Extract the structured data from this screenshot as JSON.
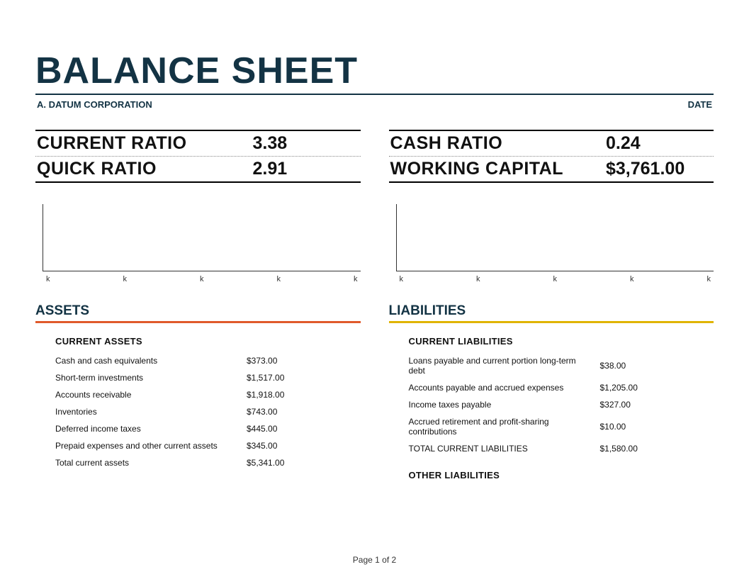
{
  "header": {
    "title": "BALANCE SHEET",
    "company": "A. DATUM CORPORATION",
    "date_label": "DATE"
  },
  "ratios": {
    "left": [
      {
        "label": "CURRENT RATIO",
        "value": "3.38"
      },
      {
        "label": "QUICK RATIO",
        "value": "2.91"
      }
    ],
    "right": [
      {
        "label": "CASH RATIO",
        "value": "0.24"
      },
      {
        "label": "WORKING CAPITAL",
        "value": "$3,761.00"
      }
    ]
  },
  "chart_data": [
    {
      "type": "bar",
      "categories": [
        "k",
        "k",
        "k",
        "k",
        "k"
      ],
      "values": [],
      "title": "",
      "xlabel": "",
      "ylabel": ""
    },
    {
      "type": "bar",
      "categories": [
        "k",
        "k",
        "k",
        "k",
        "k"
      ],
      "values": [],
      "title": "",
      "xlabel": "",
      "ylabel": ""
    }
  ],
  "assets": {
    "title": "ASSETS",
    "current": {
      "title": "CURRENT ASSETS",
      "items": [
        {
          "label": "Cash and cash equivalents",
          "value": "$373.00"
        },
        {
          "label": "Short-term investments",
          "value": "$1,517.00"
        },
        {
          "label": "Accounts receivable",
          "value": "$1,918.00"
        },
        {
          "label": "Inventories",
          "value": "$743.00"
        },
        {
          "label": "Deferred income taxes",
          "value": "$445.00"
        },
        {
          "label": "Prepaid expenses and other current assets",
          "value": "$345.00"
        },
        {
          "label": "Total current assets",
          "value": "$5,341.00"
        }
      ]
    }
  },
  "liabilities": {
    "title": "LIABILITIES",
    "current": {
      "title": "CURRENT LIABILITIES",
      "items": [
        {
          "label": "Loans payable and current portion long-term debt",
          "value": "$38.00"
        },
        {
          "label": "Accounts payable and accrued expenses",
          "value": "$1,205.00"
        },
        {
          "label": "Income taxes payable",
          "value": "$327.00"
        },
        {
          "label": "Accrued retirement and profit-sharing contributions",
          "value": "$10.00"
        },
        {
          "label": "TOTAL CURRENT LIABILITIES",
          "value": "$1,580.00"
        }
      ]
    },
    "other": {
      "title": "OTHER LIABILITIES"
    }
  },
  "footer": {
    "page": "Page 1 of 2"
  }
}
